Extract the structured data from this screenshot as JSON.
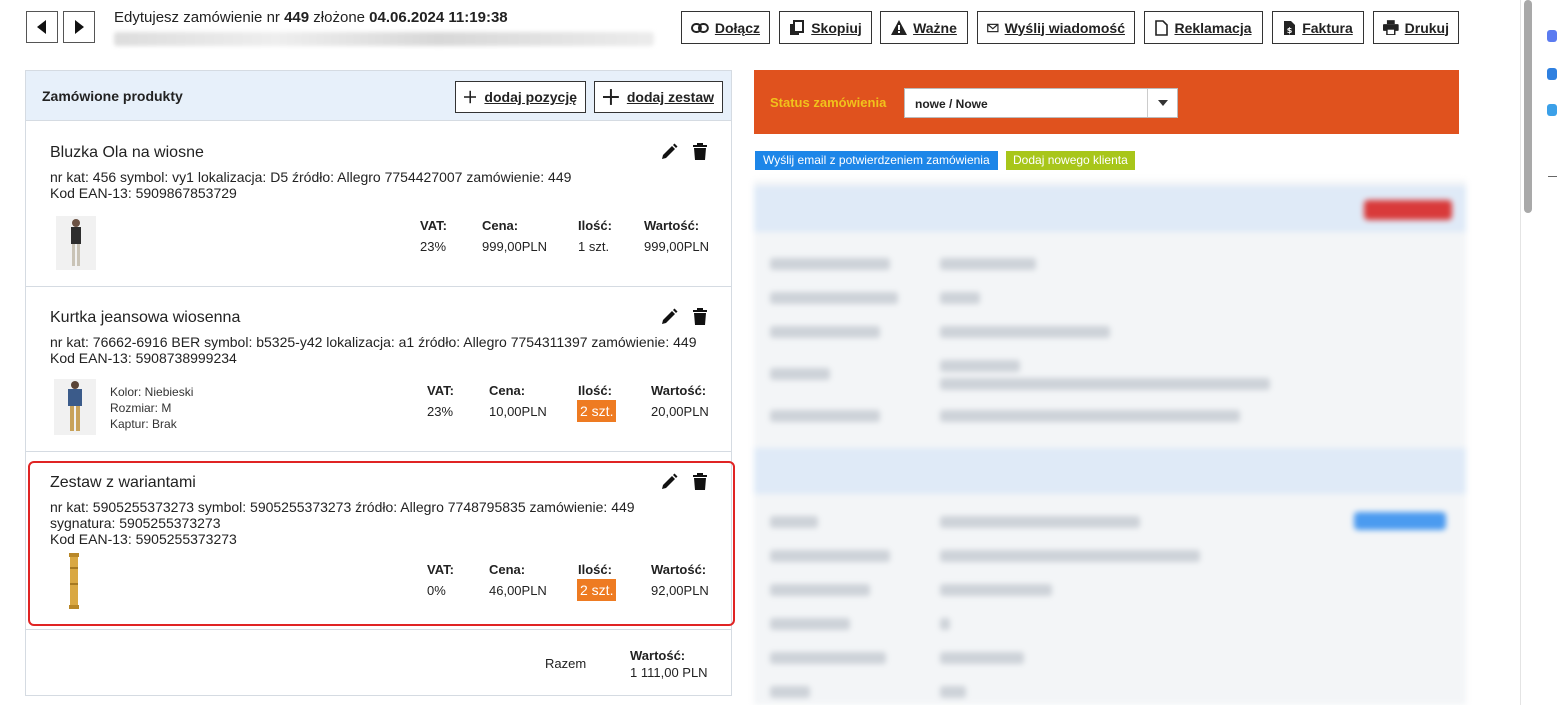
{
  "header": {
    "title_prefix": "Edytujesz zamówienie nr",
    "order_number": "449",
    "title_mid": "złożone",
    "order_date": "04.06.2024 11:19:38",
    "buttons": {
      "attach": "Dołącz",
      "copy": "Skopiuj",
      "important": "Ważne",
      "send_message": "Wyślij wiadomość",
      "complaint": "Reklamacja",
      "invoice": "Faktura",
      "print": "Drukuj"
    }
  },
  "products": {
    "title": "Zamówione produkty",
    "add_item": "dodaj pozycję",
    "add_set": "dodaj zestaw",
    "columns": {
      "vat": "VAT:",
      "price": "Cena:",
      "qty": "Ilość:",
      "value": "Wartość:"
    },
    "items": [
      {
        "name": "Bluzka Ola na wiosne",
        "meta1": "nr kat: 456 symbol: vy1 lokalizacja: D5 źródło: Allegro 7754427007 zamówienie: 449",
        "meta2": "Kod EAN-13: 5909867853729",
        "vat": "23%",
        "price": "999,00PLN",
        "qty": "1 szt.",
        "value": "999,00PLN"
      },
      {
        "name": "Kurtka jeansowa wiosenna",
        "meta1": "nr kat: 76662-6916 BER symbol: b5325-y42 lokalizacja: a1 źródło: Allegro 7754311397 zamówienie: 449",
        "meta2": "Kod EAN-13: 5908738999234",
        "attr1": "Kolor: Niebieski",
        "attr2": "Rozmiar: M",
        "attr3": "Kaptur: Brak",
        "vat": "23%",
        "price": "10,00PLN",
        "qty": "2 szt.",
        "value": "20,00PLN"
      },
      {
        "name": "Zestaw z wariantami",
        "meta1": "nr kat: 5905255373273 symbol: 5905255373273 źródło: Allegro 7748795835 zamówienie: 449",
        "meta2": "sygnatura: 5905255373273",
        "meta3": "Kod EAN-13: 5905255373273",
        "vat": "0%",
        "price": "46,00PLN",
        "qty": "2 szt.",
        "value": "92,00PLN"
      }
    ],
    "total_label": "Razem",
    "total_header": "Wartość:",
    "total_value": "1 111,00 PLN"
  },
  "status": {
    "label": "Status zamówienia",
    "value": "nowe / Nowe"
  },
  "actions": {
    "send_email": "Wyślij email z potwierdzeniem zamówienia",
    "add_client": "Dodaj nowego klienta"
  },
  "colors": {
    "status_bar": "#e0521e",
    "qty_badge": "#ee7b22",
    "highlight": "#e02424",
    "blue_button": "#1d86e8",
    "green_button": "#a8c61a"
  }
}
